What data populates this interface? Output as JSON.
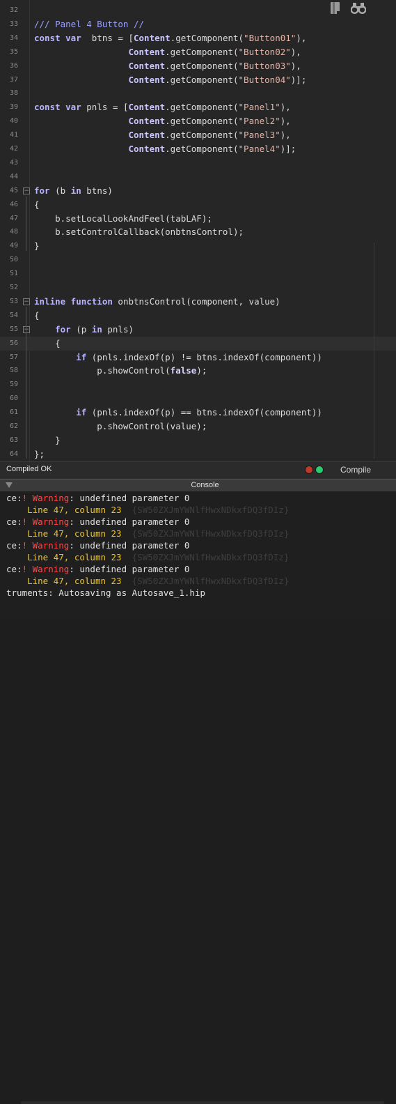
{
  "editor": {
    "lines": [
      {
        "n": "32",
        "tokens": []
      },
      {
        "n": "33",
        "tokens": [
          [
            "cm",
            "/// Panel 4 Button //"
          ]
        ]
      },
      {
        "n": "34",
        "tokens": [
          [
            "kw",
            "const var"
          ],
          [
            "",
            "  btns = ["
          ],
          [
            "cls",
            "Content"
          ],
          [
            "",
            ".getComponent("
          ],
          [
            "str",
            "\"Button01\""
          ],
          [
            "",
            "),"
          ]
        ]
      },
      {
        "n": "35",
        "tokens": [
          [
            "",
            "                  "
          ],
          [
            "cls",
            "Content"
          ],
          [
            "",
            ".getComponent("
          ],
          [
            "str",
            "\"Button02\""
          ],
          [
            "",
            "),"
          ]
        ]
      },
      {
        "n": "36",
        "tokens": [
          [
            "",
            "                  "
          ],
          [
            "cls",
            "Content"
          ],
          [
            "",
            ".getComponent("
          ],
          [
            "str",
            "\"Button03\""
          ],
          [
            "",
            "),"
          ]
        ]
      },
      {
        "n": "37",
        "tokens": [
          [
            "",
            "                  "
          ],
          [
            "cls",
            "Content"
          ],
          [
            "",
            ".getComponent("
          ],
          [
            "str",
            "\"Button04\""
          ],
          [
            "",
            ")];"
          ]
        ]
      },
      {
        "n": "38",
        "tokens": []
      },
      {
        "n": "39",
        "tokens": [
          [
            "kw",
            "const var"
          ],
          [
            "",
            " pnls = ["
          ],
          [
            "cls",
            "Content"
          ],
          [
            "",
            ".getComponent("
          ],
          [
            "str",
            "\"Panel1\""
          ],
          [
            "",
            "),"
          ]
        ]
      },
      {
        "n": "40",
        "tokens": [
          [
            "",
            "                  "
          ],
          [
            "cls",
            "Content"
          ],
          [
            "",
            ".getComponent("
          ],
          [
            "str",
            "\"Panel2\""
          ],
          [
            "",
            "),"
          ]
        ]
      },
      {
        "n": "41",
        "tokens": [
          [
            "",
            "                  "
          ],
          [
            "cls",
            "Content"
          ],
          [
            "",
            ".getComponent("
          ],
          [
            "str",
            "\"Panel3\""
          ],
          [
            "",
            "),"
          ]
        ]
      },
      {
        "n": "42",
        "tokens": [
          [
            "",
            "                  "
          ],
          [
            "cls",
            "Content"
          ],
          [
            "",
            ".getComponent("
          ],
          [
            "str",
            "\"Panel4\""
          ],
          [
            "",
            ")];"
          ]
        ]
      },
      {
        "n": "43",
        "tokens": []
      },
      {
        "n": "44",
        "tokens": []
      },
      {
        "n": "45",
        "fold": "−",
        "tokens": [
          [
            "kw",
            "for"
          ],
          [
            "",
            " (b "
          ],
          [
            "kw",
            "in"
          ],
          [
            "",
            " btns)"
          ]
        ]
      },
      {
        "n": "46",
        "tokens": [
          [
            "",
            "{"
          ]
        ]
      },
      {
        "n": "47",
        "tokens": [
          [
            "",
            "    b.setLocalLookAndFeel(tabLAF);"
          ]
        ]
      },
      {
        "n": "48",
        "tokens": [
          [
            "",
            "    b.setControlCallback(onbtnsControl);"
          ]
        ]
      },
      {
        "n": "49",
        "tokens": [
          [
            "",
            "}"
          ]
        ]
      },
      {
        "n": "50",
        "tokens": []
      },
      {
        "n": "51",
        "tokens": []
      },
      {
        "n": "52",
        "tokens": []
      },
      {
        "n": "53",
        "fold": "−",
        "tokens": [
          [
            "kw",
            "inline function"
          ],
          [
            "",
            " onbtnsControl(component, value)"
          ]
        ]
      },
      {
        "n": "54",
        "tokens": [
          [
            "",
            "{"
          ]
        ]
      },
      {
        "n": "55",
        "fold": "−",
        "tokens": [
          [
            "",
            "    "
          ],
          [
            "kw",
            "for"
          ],
          [
            "",
            " (p "
          ],
          [
            "kw",
            "in"
          ],
          [
            "",
            " pnls)"
          ]
        ]
      },
      {
        "n": "56",
        "active": true,
        "tokens": [
          [
            "",
            "    {"
          ]
        ]
      },
      {
        "n": "57",
        "tokens": [
          [
            "",
            "        "
          ],
          [
            "kw",
            "if"
          ],
          [
            "",
            " (pnls.indexOf(p) != btns.indexOf(component))"
          ]
        ]
      },
      {
        "n": "58",
        "tokens": [
          [
            "",
            "            p.showControl("
          ],
          [
            "bool",
            "false"
          ],
          [
            "",
            ");"
          ]
        ]
      },
      {
        "n": "59",
        "tokens": []
      },
      {
        "n": "60",
        "tokens": []
      },
      {
        "n": "61",
        "tokens": [
          [
            "",
            "        "
          ],
          [
            "kw",
            "if"
          ],
          [
            "",
            " (pnls.indexOf(p) == btns.indexOf(component))"
          ]
        ]
      },
      {
        "n": "62",
        "tokens": [
          [
            "",
            "            p.showControl(value);"
          ]
        ]
      },
      {
        "n": "63",
        "tokens": [
          [
            "",
            "    }"
          ]
        ]
      },
      {
        "n": "64",
        "tokens": [
          [
            "",
            "};"
          ]
        ]
      }
    ]
  },
  "toolbar": {
    "bookmark_icon": "bookmark-icon",
    "search_icon": "binoculars-icon"
  },
  "status": {
    "text": "Compiled OK",
    "compile_label": "Compile",
    "indicator_colors": [
      "#c0392b",
      "#2ecc71"
    ]
  },
  "console": {
    "title": "Console",
    "entries": [
      {
        "prefix": "ce:",
        "mark": "!",
        "label": "Warning",
        "message": ": undefined parameter 0",
        "location": "Line 47, column 23",
        "ref": "{SW50ZXJmYWNlfHwxNDkxfDQ3fDIz}"
      },
      {
        "prefix": "ce:",
        "mark": "!",
        "label": "Warning",
        "message": ": undefined parameter 0",
        "location": "Line 47, column 23",
        "ref": "{SW50ZXJmYWNlfHwxNDkxfDQ3fDIz}"
      },
      {
        "prefix": "ce:",
        "mark": "!",
        "label": "Warning",
        "message": ": undefined parameter 0",
        "location": "Line 47, column 23",
        "ref": "{SW50ZXJmYWNlfHwxNDkxfDQ3fDIz}"
      },
      {
        "prefix": "ce:",
        "mark": "!",
        "label": "Warning",
        "message": ": undefined parameter 0",
        "location": "Line 47, column 23",
        "ref": "{SW50ZXJmYWNlfHwxNDkxfDQ3fDIz}"
      }
    ],
    "last_line": "truments: Autosaving as Autosave_1.hip"
  }
}
